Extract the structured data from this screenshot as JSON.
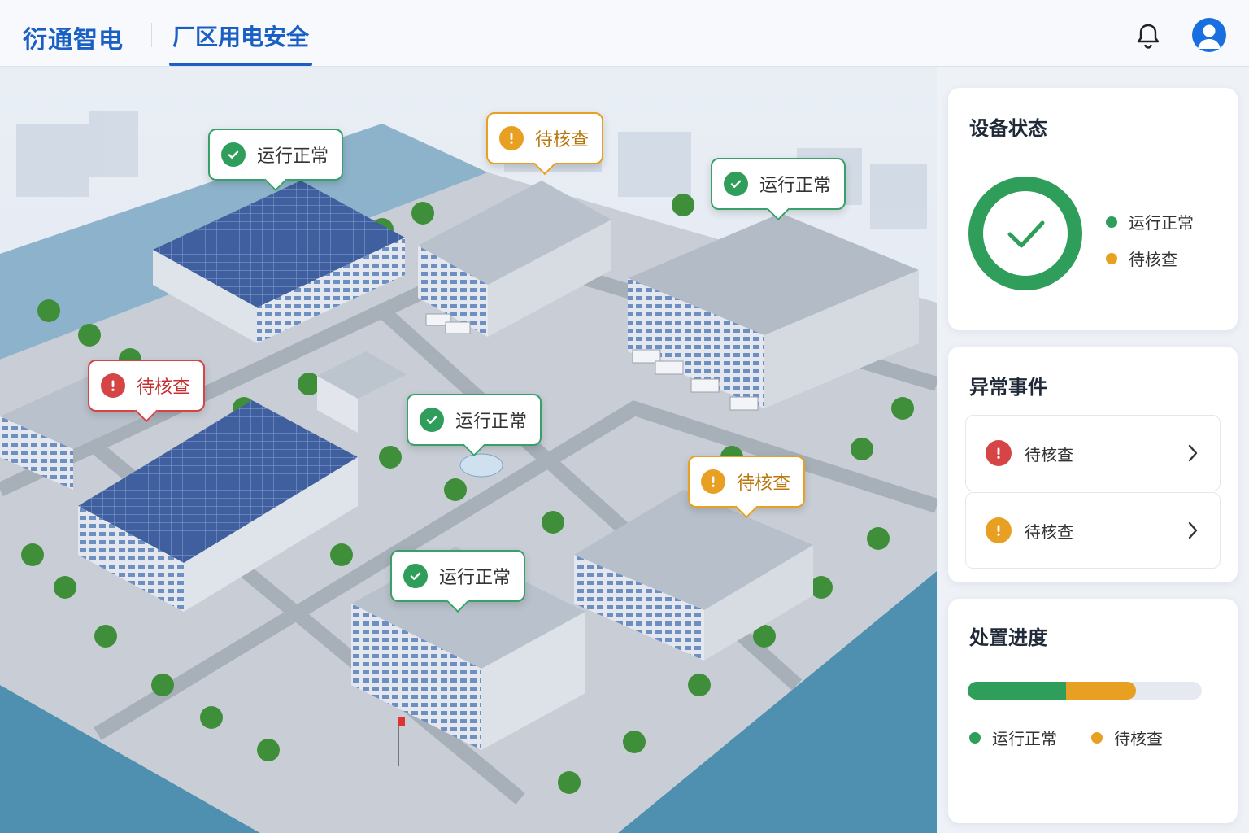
{
  "header": {
    "brand": "衍通智电",
    "active_tab": "厂区用电安全",
    "icons": [
      "bell-icon",
      "user-avatar-icon"
    ]
  },
  "colors": {
    "brand": "#1a5fc4",
    "normal": "#2f9e5b",
    "warning": "#e8a023",
    "danger": "#d64545"
  },
  "map_callouts": [
    {
      "status": "normal",
      "icon": "check-circle-icon",
      "label": "运行正常"
    },
    {
      "status": "warning",
      "icon": "exclamation-circle-icon",
      "label": "待核查"
    },
    {
      "status": "normal",
      "icon": "check-circle-icon",
      "label": "运行正常"
    },
    {
      "status": "danger",
      "icon": "exclamation-circle-icon",
      "label": "待核查"
    },
    {
      "status": "normal",
      "icon": "check-circle-icon",
      "label": "运行正常"
    },
    {
      "status": "warning",
      "icon": "exclamation-circle-icon",
      "label": "待核查"
    },
    {
      "status": "normal",
      "icon": "check-circle-icon",
      "label": "运行正常"
    }
  ],
  "device_status": {
    "title": "设备状态",
    "icon": "check-ring-icon",
    "legend": [
      {
        "label": "运行正常",
        "color": "#2f9e5b"
      },
      {
        "label": "待核查",
        "color": "#e8a023"
      }
    ]
  },
  "anomaly_events": {
    "title": "异常事件",
    "items": [
      {
        "label": "待核查",
        "severity": "danger",
        "icon": "exclamation-circle-icon"
      },
      {
        "label": "待核查",
        "severity": "warning",
        "icon": "exclamation-circle-icon"
      }
    ]
  },
  "progress": {
    "title": "处置进度",
    "normal_fraction": 0.42,
    "pending_fraction": 0.3,
    "legend": [
      {
        "label": "运行正常",
        "color": "#2f9e5b"
      },
      {
        "label": "待核查",
        "color": "#e8a023"
      }
    ]
  }
}
